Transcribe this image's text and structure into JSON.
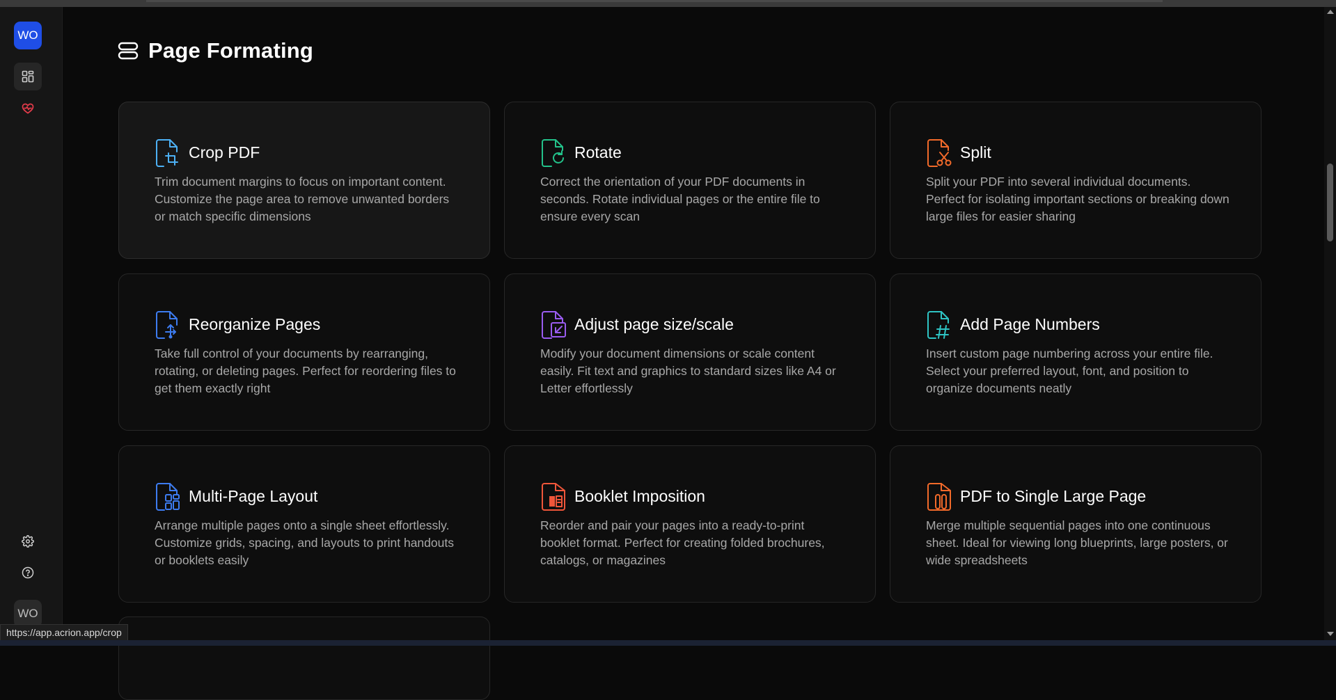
{
  "sidebar": {
    "workspace_initials": "WO",
    "user_initials": "WO",
    "items": [
      {
        "icon": "dashboard-grid-icon"
      },
      {
        "icon": "heart-pulse-icon",
        "color": "#e23b4a"
      },
      {
        "icon": "gear-icon"
      },
      {
        "icon": "help-circle-icon"
      }
    ]
  },
  "page": {
    "title": "Page Formating",
    "title_icon": "layers-icon"
  },
  "cards": [
    {
      "title": "Crop PDF",
      "icon": "crop-file-icon",
      "color": "#4db1f5",
      "description": "Trim document margins to focus on important content. Customize the page area to remove unwanted borders or match specific dimensions"
    },
    {
      "title": "Rotate",
      "icon": "rotate-file-icon",
      "color": "#23c28a",
      "description": "Correct the orientation of your PDF documents in seconds. Rotate individual pages or the entire file to ensure every scan"
    },
    {
      "title": "Split",
      "icon": "scissors-file-icon",
      "color": "#f26a2a",
      "description": "Split your PDF into several individual documents. Perfect for isolating important sections or breaking down large files for easier sharing"
    },
    {
      "title": "Reorganize Pages",
      "icon": "reorganize-file-icon",
      "color": "#3d7cf0",
      "description": "Take full control of your documents by rearranging, rotating, or deleting pages. Perfect for reordering files to get them exactly right"
    },
    {
      "title": "Adjust page size/scale",
      "icon": "resize-file-icon",
      "color": "#9a5cf0",
      "description": "Modify your document dimensions or scale content easily. Fit text and graphics to standard sizes like A4 or Letter effortlessly"
    },
    {
      "title": "Add Page Numbers",
      "icon": "hash-file-icon",
      "color": "#2ec4c4",
      "description": "Insert custom page numbering across your entire file. Select your preferred layout, font, and position to organize documents neatly"
    },
    {
      "title": "Multi-Page Layout",
      "icon": "grid-file-icon",
      "color": "#3d7cf0",
      "description": "Arrange multiple pages onto a single sheet effortlessly. Customize grids, spacing, and layouts to print handouts or booklets easily"
    },
    {
      "title": "Booklet Imposition",
      "icon": "booklet-file-icon",
      "color": "#f0563a",
      "description": "Reorder and pair your pages into a ready-to-print booklet format. Perfect for creating folded brochures, catalogs, or magazines"
    },
    {
      "title": "PDF to Single Large Page",
      "icon": "merge-pages-file-icon",
      "color": "#f26a2a",
      "description": "Merge multiple sequential pages into one continuous sheet. Ideal for viewing long blueprints, large posters, or wide spreadsheets"
    }
  ],
  "status_url": "https://app.acrion.app/crop"
}
